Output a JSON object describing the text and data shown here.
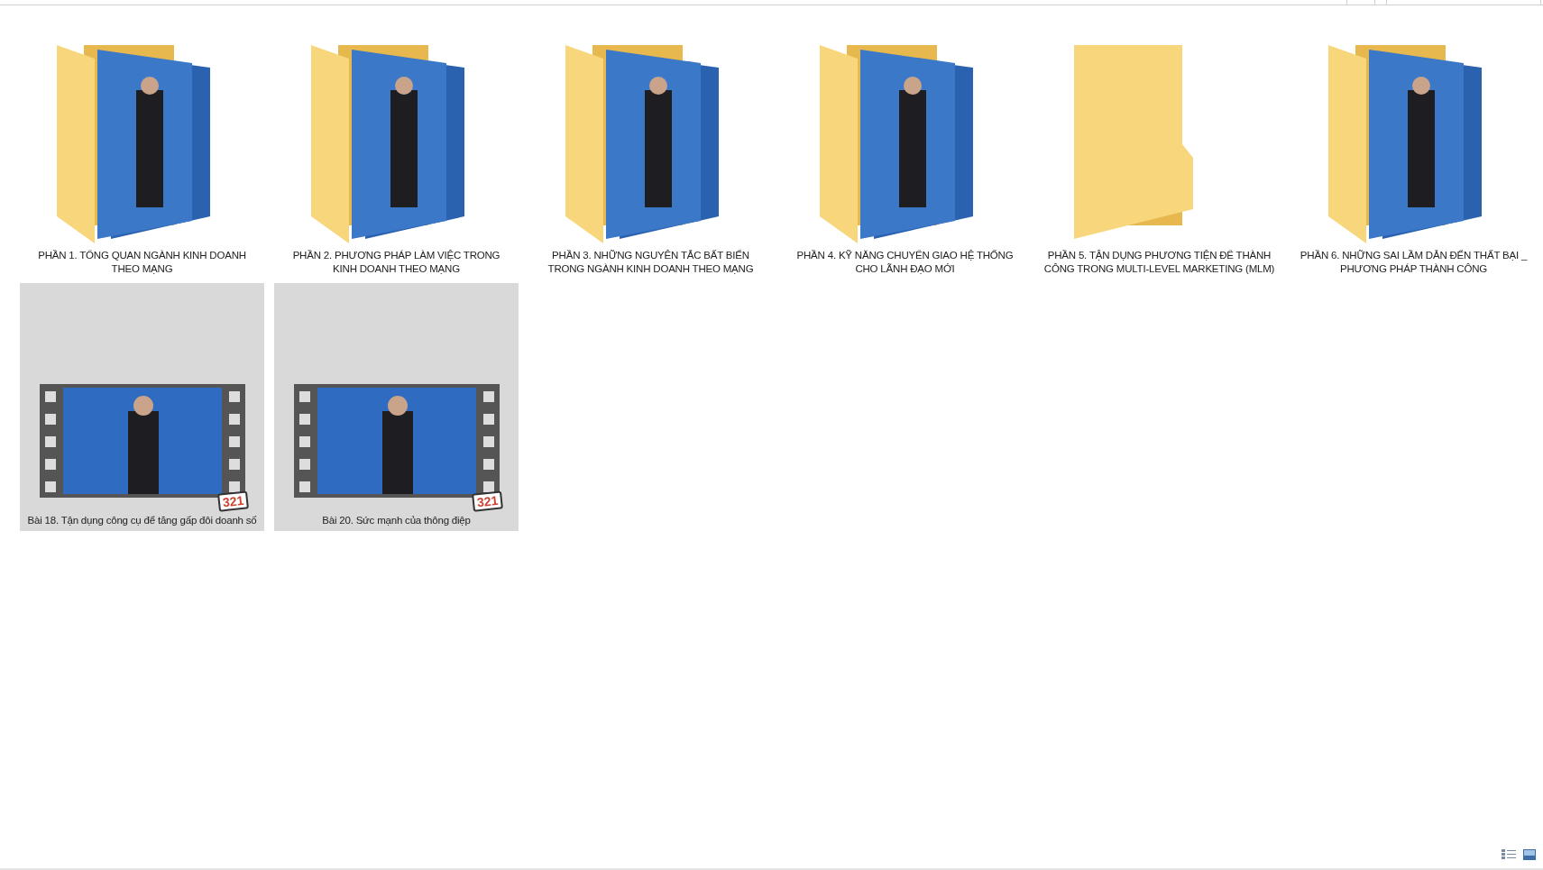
{
  "items": [
    {
      "kind": "folder",
      "name": "PHẦN 1. TỔNG QUAN NGÀNH KINH DOANH THEO MẠNG",
      "preview": true,
      "selected": false
    },
    {
      "kind": "folder",
      "name": "PHẦN 2. PHƯƠNG PHÁP LÀM VIỆC TRONG KINH DOANH THEO MẠNG",
      "preview": true,
      "selected": false
    },
    {
      "kind": "folder",
      "name": "PHẦN 3. NHỮNG NGUYÊN TẮC BẤT BIẾN TRONG NGÀNH KINH DOANH THEO MẠNG",
      "preview": true,
      "selected": false
    },
    {
      "kind": "folder",
      "name": "PHẦN 4. KỸ NĂNG CHUYỂN GIAO HỆ THỐNG CHO LÃNH ĐẠO MỚI",
      "preview": true,
      "selected": false
    },
    {
      "kind": "folder",
      "name": "PHẦN 5. TẬN DỤNG PHƯƠNG TIỆN ĐỂ THÀNH CÔNG TRONG MULTI-LEVEL MARKETING (MLM)",
      "preview": false,
      "selected": false
    },
    {
      "kind": "folder",
      "name": "PHẦN 6. NHỮNG SAI LẦM DẪN ĐẾN THẤT BẠI _ PHƯƠNG PHÁP THÀNH CÔNG",
      "preview": true,
      "selected": false
    },
    {
      "kind": "video",
      "name": "Bài 18. Tận dụng công cụ để tăng gấp đôi doanh số",
      "badge": "321",
      "selected": true
    },
    {
      "kind": "video",
      "name": "Bài 20. Sức mạnh của thông điệp",
      "badge": "321",
      "selected": true
    }
  ]
}
